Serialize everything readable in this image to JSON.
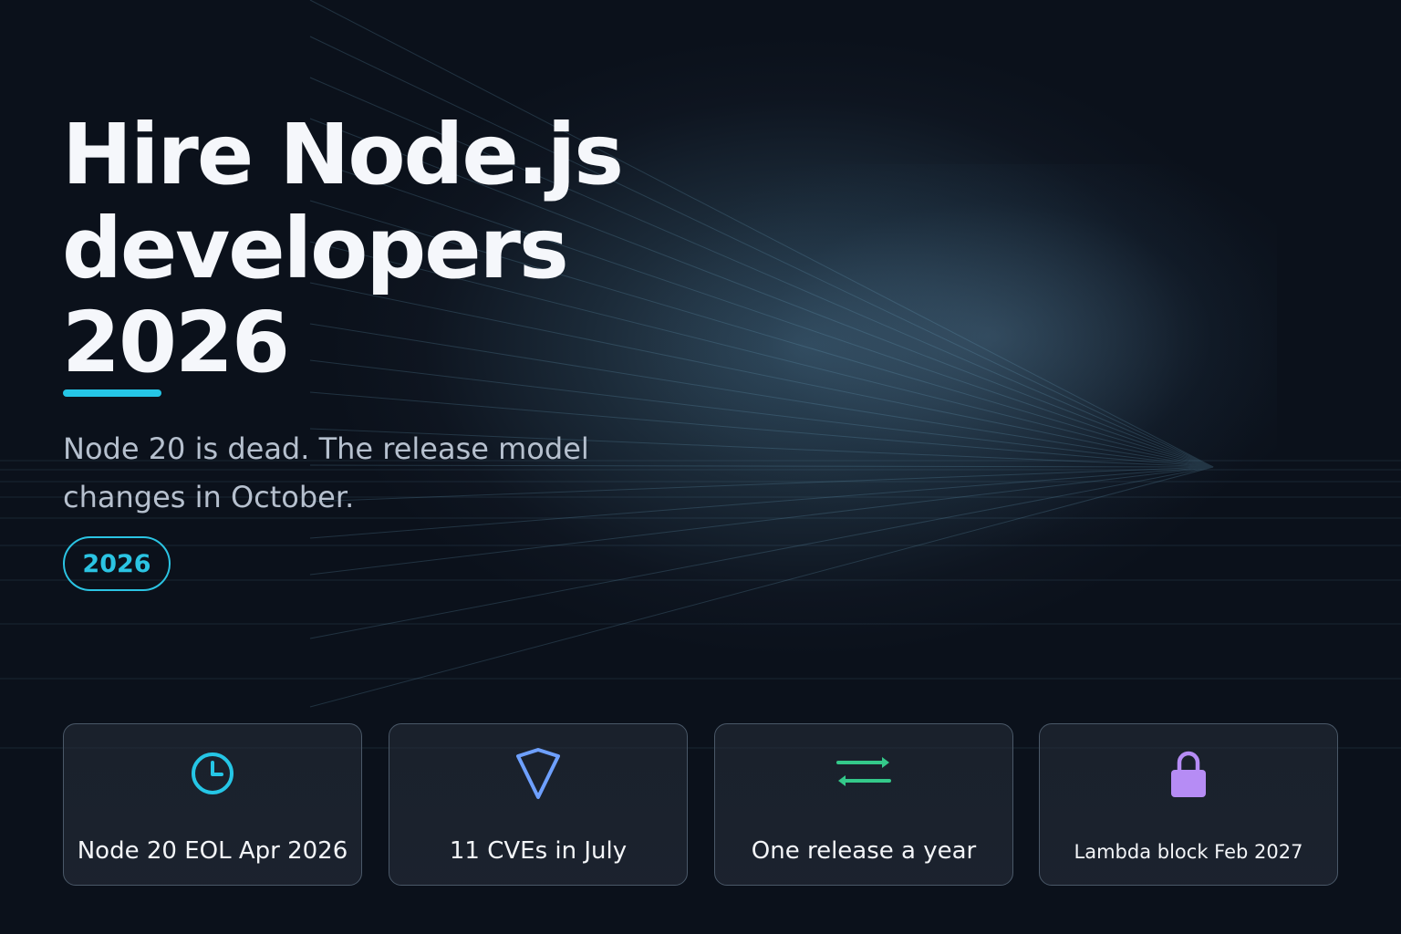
{
  "hero": {
    "title_line1": "Hire Node.js",
    "title_line2": "developers",
    "title_line3": "2026",
    "subtitle": "Node 20 is dead. The release model changes in October.",
    "badge": "2026"
  },
  "colors": {
    "accent_cyan": "#25c6e6",
    "accent_blue": "#6ea0ff",
    "accent_green": "#34c98a",
    "accent_purple": "#b68cf5"
  },
  "cards": [
    {
      "icon": "clock-icon",
      "label": "Node 20 EOL Apr 2026"
    },
    {
      "icon": "diamond-icon",
      "label": "11 CVEs in July"
    },
    {
      "icon": "swap-arrows-icon",
      "label": "One release a year"
    },
    {
      "icon": "lock-icon",
      "label": "Lambda block Feb 2027"
    }
  ]
}
